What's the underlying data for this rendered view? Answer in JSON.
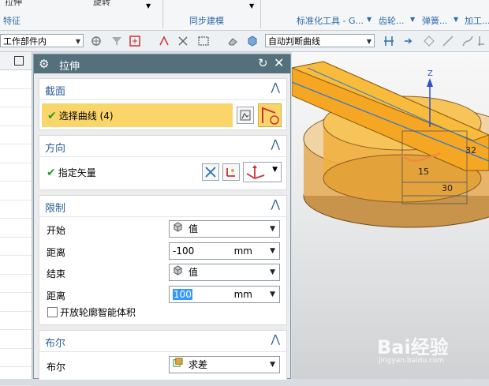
{
  "ribbon": {
    "groups": [
      "特征",
      "同步建模",
      "标准化工具 - G...",
      "齿轮...",
      "弹簧...",
      "加工..."
    ],
    "top_fragments": [
      "拉伸",
      "旋转"
    ]
  },
  "toolbar": {
    "scope_combo": "工作部件内",
    "curve_rule_combo": "自动判断曲线"
  },
  "dialog": {
    "title": "拉伸",
    "section_label": "截面",
    "select_curve": "选择曲线 (4)",
    "direction_label": "方向",
    "vector_label": "指定矢量",
    "limits_label": "限制",
    "start_label": "开始",
    "start_value": "值",
    "distance_label": "距离",
    "start_distance": "-100",
    "unit": "mm",
    "end_label": "结束",
    "end_value": "值",
    "end_distance": "100",
    "open_profile_label": "开放轮廓智能体积",
    "boolean_section": "布尔",
    "boolean_label": "布尔",
    "boolean_value": "求差"
  },
  "viewport": {
    "axis_z": "Z",
    "dim_a": "15",
    "dim_b": "30",
    "dim_c": "32"
  },
  "watermark": {
    "text": "Bai经验",
    "url": "jingyan.baidu.com"
  },
  "colors": {
    "title_bar": "#55707d",
    "section_label": "#2e5f95",
    "selection_highlight": "#fad56a",
    "part_orange": "#f5a623",
    "check_green": "#2a9a2a"
  }
}
